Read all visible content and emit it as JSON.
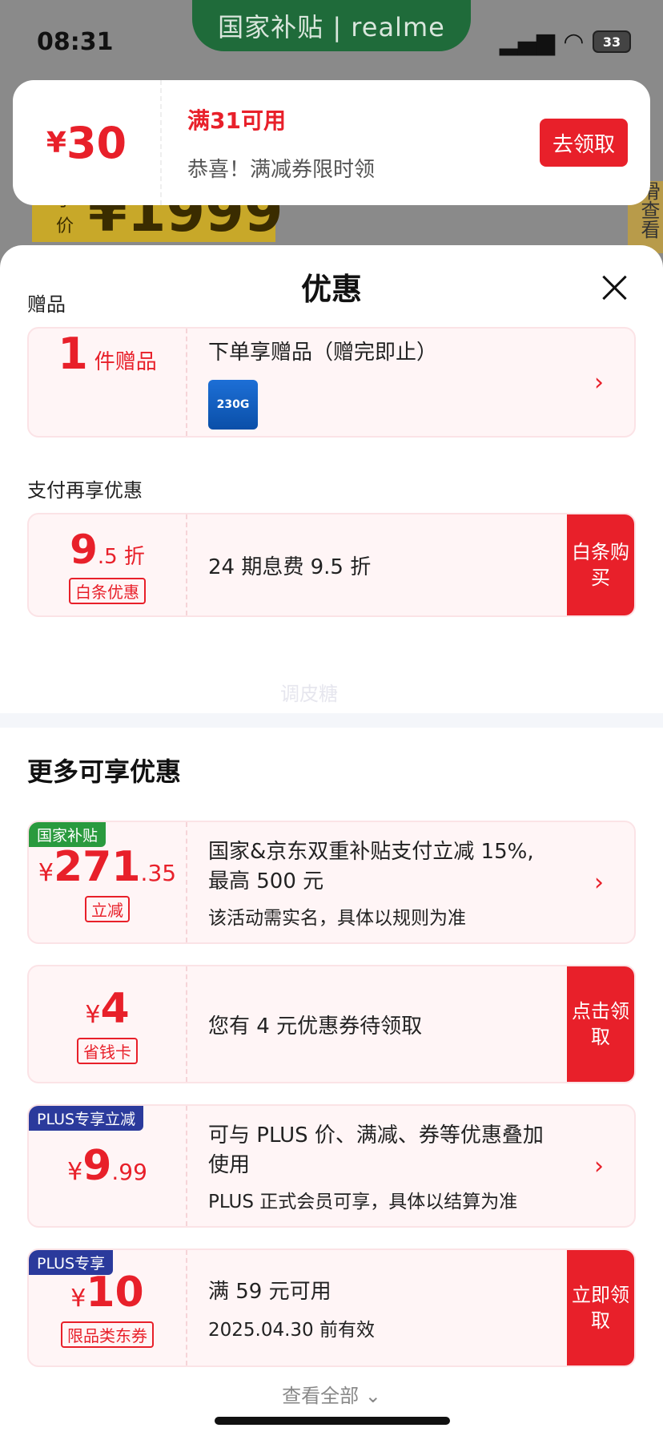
{
  "status_bar": {
    "time": "08:31",
    "battery": "33"
  },
  "banner": {
    "text": "国家补贴 | realme"
  },
  "background": {
    "price_prefix": "手价",
    "price": "¥1999",
    "side": "滑查看"
  },
  "top_coupon": {
    "amount_symbol": "¥",
    "amount": "30",
    "condition": "满31可用",
    "desc": "恭喜！满减券限时领",
    "button": "去领取"
  },
  "sheet": {
    "title": "优惠",
    "gift_section": "赠品",
    "gift": {
      "count": "1",
      "unit": "件赠品",
      "title": "下单享赠品（赠完即止）",
      "icon_text": "230G"
    },
    "pay_section": "支付再享优惠",
    "pay": {
      "big": "9",
      "small": ".5 折",
      "badge": "白条优惠",
      "desc": "24 期息费 9.5 折",
      "cta": "白条购买"
    },
    "more_title": "更多可享优惠",
    "offers": [
      {
        "tag": "国家补贴",
        "symbol": "¥",
        "big": "271",
        "small": ".35",
        "badge": "立减",
        "line1": "国家&京东双重补贴支付立减 15%,",
        "line2": "最高 500 元",
        "line3": "该活动需实名，具体以规则为准"
      },
      {
        "symbol": "¥",
        "big": "4",
        "badge": "省钱卡",
        "line1": "您有 4 元优惠券待领取",
        "cta": "点击领取"
      },
      {
        "tag": "PLUS专享立减",
        "symbol": "¥",
        "big": "9",
        "small": ".99",
        "line1": "可与 PLUS 价、满减、券等优惠叠加",
        "line2": "使用",
        "line3": "PLUS 正式会员可享，具体以结算为准"
      },
      {
        "tag": "PLUS专享",
        "symbol": "¥",
        "big": "10",
        "badge": "限品类东券",
        "line1": "满 59 元可用",
        "line2": "2025.04.30 前有效",
        "cta": "立即领取"
      }
    ],
    "view_all": "查看全部 ⌄"
  }
}
